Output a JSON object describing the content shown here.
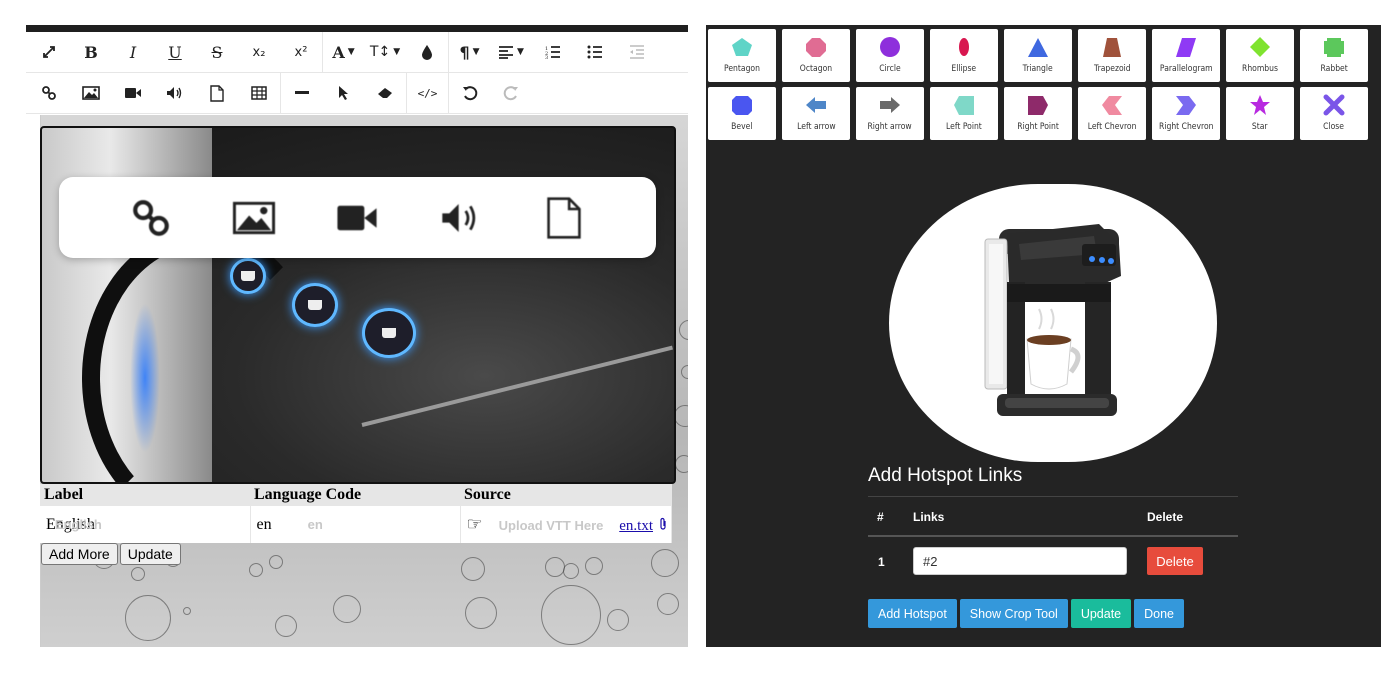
{
  "editor": {
    "toolbar_row1": [
      {
        "name": "fullscreen-icon"
      },
      {
        "name": "bold-button",
        "label": "B"
      },
      {
        "name": "italic-button",
        "label": "I"
      },
      {
        "name": "underline-button",
        "label": "U"
      },
      {
        "name": "strikethrough-button",
        "label": "S"
      },
      {
        "name": "subscript-button",
        "label": "x₂"
      },
      {
        "name": "superscript-button",
        "label": "x²"
      },
      {
        "name": "font-color-button",
        "label": "A"
      },
      {
        "name": "font-size-button",
        "label": "T↕"
      },
      {
        "name": "highlight-icon"
      },
      {
        "name": "paragraph-button",
        "label": "¶"
      },
      {
        "name": "align-button"
      },
      {
        "name": "ordered-list-icon"
      },
      {
        "name": "unordered-list-icon"
      },
      {
        "name": "outdent-icon"
      }
    ],
    "toolbar_row2": [
      {
        "name": "link-icon"
      },
      {
        "name": "image-icon"
      },
      {
        "name": "video-icon"
      },
      {
        "name": "audio-icon"
      },
      {
        "name": "file-icon"
      },
      {
        "name": "table-icon"
      },
      {
        "name": "horizontal-rule-icon"
      },
      {
        "name": "select-cursor-icon"
      },
      {
        "name": "eraser-icon"
      },
      {
        "name": "code-view-icon",
        "label": "</>"
      },
      {
        "name": "undo-icon"
      },
      {
        "name": "redo-icon"
      }
    ],
    "media_popup_icons": [
      "link-icon",
      "image-icon",
      "video-icon",
      "audio-icon",
      "file-icon"
    ],
    "track_table": {
      "headers": [
        "Label",
        "Language Code",
        "Source"
      ],
      "row": {
        "label": "English",
        "label_placeholder": "English",
        "language_code": "en",
        "language_placeholder": "en",
        "upload_placeholder": "Upload VTT Here",
        "file_link": "en.txt"
      }
    },
    "buttons": {
      "add_more": "Add More",
      "update": "Update"
    }
  },
  "hotspot": {
    "shapes": [
      {
        "label": "Pentagon",
        "icon": "pentagon-icon",
        "color": "#5fd4c7"
      },
      {
        "label": "Octagon",
        "icon": "octagon-icon",
        "color": "#e06c93"
      },
      {
        "label": "Circle",
        "icon": "circle-icon",
        "color": "#8e2fdc"
      },
      {
        "label": "Ellipse",
        "icon": "ellipse-icon",
        "color": "#d8174f"
      },
      {
        "label": "Triangle",
        "icon": "triangle-icon",
        "color": "#3f68e0"
      },
      {
        "label": "Trapezoid",
        "icon": "trapezoid-icon",
        "color": "#a0523b"
      },
      {
        "label": "Parallelogram",
        "icon": "parallelogram-icon",
        "color": "#8f3af5"
      },
      {
        "label": "Rhombus",
        "icon": "rhombus-icon",
        "color": "#7fe32f"
      },
      {
        "label": "Rabbet",
        "icon": "rabbet-icon",
        "color": "#5cc85c"
      },
      {
        "label": "Bevel",
        "icon": "bevel-icon",
        "color": "#4a56f0"
      },
      {
        "label": "Left arrow",
        "icon": "left-arrow-icon",
        "color": "#4e86c8"
      },
      {
        "label": "Right arrow",
        "icon": "right-arrow-icon",
        "color": "#6a6a6a"
      },
      {
        "label": "Left Point",
        "icon": "left-point-icon",
        "color": "#7fd8c8"
      },
      {
        "label": "Right Point",
        "icon": "right-point-icon",
        "color": "#8e2a6a"
      },
      {
        "label": "Left Chevron",
        "icon": "left-chevron-icon",
        "color": "#f08aa0"
      },
      {
        "label": "Right Chevron",
        "icon": "right-chevron-icon",
        "color": "#7a6af0"
      },
      {
        "label": "Star",
        "icon": "star-icon",
        "color": "#b82ae0"
      },
      {
        "label": "Close",
        "icon": "close-icon",
        "color": "#7a55e8"
      }
    ],
    "title": "Add Hotspot Links",
    "table": {
      "headers": {
        "num": "#",
        "links": "Links",
        "delete": "Delete"
      },
      "rows": [
        {
          "num": "1",
          "link": "#2",
          "delete_label": "Delete"
        }
      ]
    },
    "buttons": [
      {
        "label": "Add Hotspot",
        "color": "#3498db"
      },
      {
        "label": "Show Crop Tool",
        "color": "#3498db"
      },
      {
        "label": "Update",
        "color": "#1abc9c"
      },
      {
        "label": "Done",
        "color": "#3498db"
      }
    ]
  }
}
